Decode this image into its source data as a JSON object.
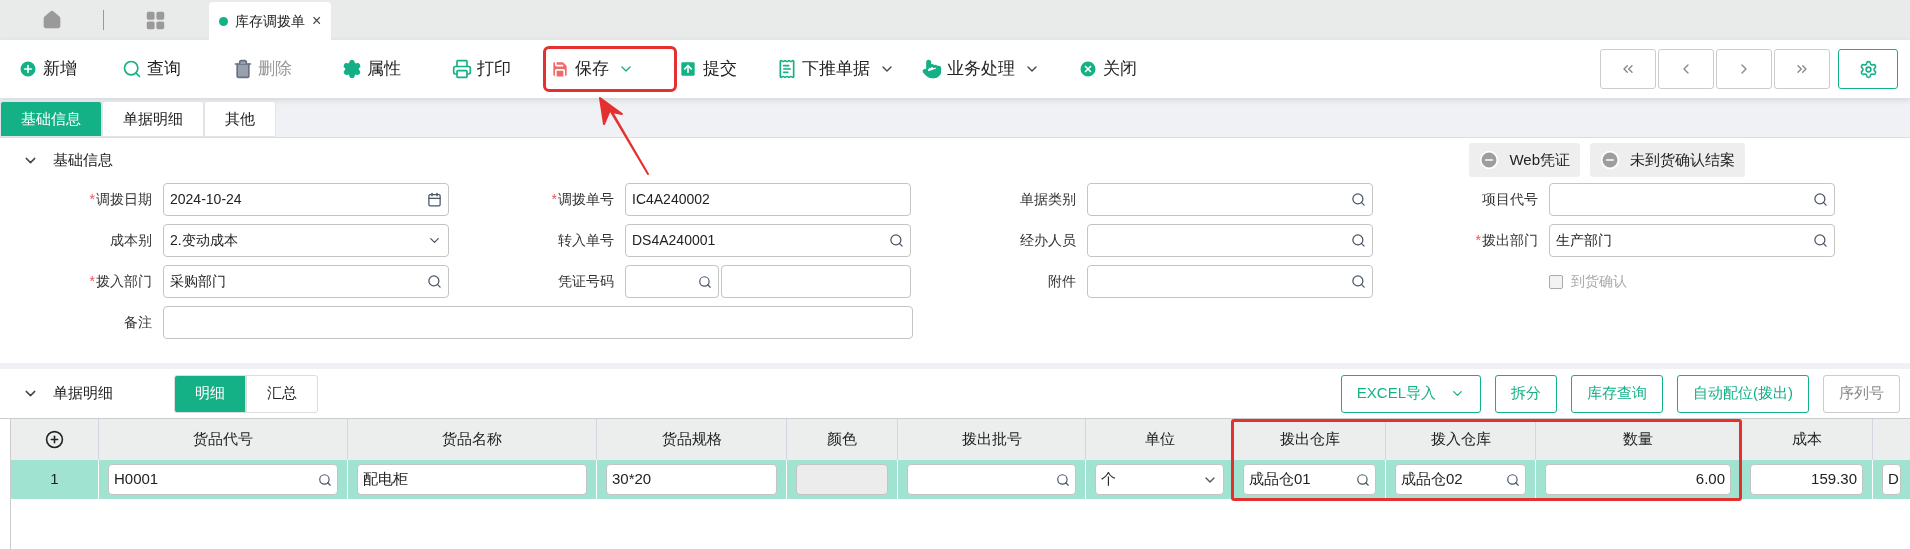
{
  "page_tabs": [
    {
      "kind": "home",
      "selected": false
    },
    {
      "kind": "apps",
      "selected": false
    },
    {
      "kind": "doc",
      "label": "库存调拨单",
      "close_glyph": "×",
      "selected": true
    }
  ],
  "toolbar": [
    {
      "label": "新增",
      "disabled": false,
      "dropdown": false,
      "highlighted": false
    },
    {
      "label": "查询",
      "disabled": false,
      "dropdown": false,
      "highlighted": false
    },
    {
      "label": "删除",
      "disabled": true,
      "dropdown": false,
      "highlighted": false
    },
    {
      "label": "属性",
      "disabled": false,
      "dropdown": false,
      "highlighted": false
    },
    {
      "label": "打印",
      "disabled": false,
      "dropdown": false,
      "highlighted": false
    },
    {
      "label": "保存",
      "disabled": false,
      "dropdown": true,
      "highlighted": true
    },
    {
      "label": "提交",
      "disabled": false,
      "dropdown": false,
      "highlighted": false
    },
    {
      "label": "下推单据",
      "disabled": false,
      "dropdown": true,
      "highlighted": false
    },
    {
      "label": "业务处理",
      "disabled": false,
      "dropdown": true,
      "highlighted": false
    },
    {
      "label": "关闭",
      "disabled": false,
      "dropdown": false,
      "highlighted": false
    }
  ],
  "form_tabs": [
    {
      "label": "基础信息",
      "selected": true
    },
    {
      "label": "单据明细",
      "selected": false
    },
    {
      "label": "其他",
      "selected": false
    }
  ],
  "basic_section": {
    "title": "基础信息",
    "expanded": true,
    "actions": [
      {
        "label": "Web凭证"
      },
      {
        "label": "未到货确认结案"
      }
    ]
  },
  "form_rows": [
    [
      {
        "label": "调拨日期",
        "required_mark": "*",
        "kind": "date",
        "value": "2024-10-24"
      },
      {
        "label": "调拨单号",
        "required_mark": "*",
        "kind": "text",
        "value": "IC4A240002"
      },
      {
        "label": "单据类别",
        "kind": "lookup"
      },
      {
        "label": "项目代号",
        "kind": "lookup"
      }
    ],
    [
      {
        "label": "成本别",
        "kind": "select",
        "value": "2.变动成本"
      },
      {
        "label": "转入单号",
        "kind": "lookup",
        "value": "DS4A240001"
      },
      {
        "label": "经办人员",
        "kind": "lookup"
      },
      {
        "label": "拨出部门",
        "required_mark": "*",
        "kind": "lookup",
        "value": "生产部门"
      }
    ],
    [
      {
        "label": "拨入部门",
        "required_mark": "*",
        "kind": "lookup",
        "value": "采购部门"
      },
      {
        "label": "凭证号码",
        "kind": "voucher"
      },
      {
        "label": "附件",
        "kind": "lookup"
      },
      {
        "label": "到货确认",
        "kind": "checkbox",
        "checked": false,
        "disabled": true
      }
    ],
    [
      {
        "label": "备注",
        "kind": "memo"
      }
    ]
  ],
  "detail_section": {
    "title": "单据明细",
    "expanded": true,
    "view_tabs": [
      {
        "label": "明细",
        "selected": true
      },
      {
        "label": "汇总",
        "selected": false
      }
    ],
    "actions": [
      {
        "label": "EXCEL导入",
        "dropdown": true,
        "disabled": false
      },
      {
        "label": "拆分",
        "dropdown": false,
        "disabled": false
      },
      {
        "label": "库存查询",
        "dropdown": false,
        "disabled": false
      },
      {
        "label": "自动配位(拨出)",
        "dropdown": false,
        "disabled": false
      },
      {
        "label": "序列号",
        "dropdown": false,
        "disabled": true
      }
    ]
  },
  "table": {
    "columns": [
      {
        "label": "货品代号",
        "highlighted": false
      },
      {
        "label": "货品名称",
        "highlighted": false
      },
      {
        "label": "货品规格",
        "highlighted": false
      },
      {
        "label": "颜色",
        "highlighted": false
      },
      {
        "label": "拨出批号",
        "highlighted": false
      },
      {
        "label": "单位",
        "highlighted": false
      },
      {
        "label": "拨出仓库",
        "highlighted": true
      },
      {
        "label": "拨入仓库",
        "highlighted": true
      },
      {
        "label": "数量",
        "highlighted": true
      },
      {
        "label": "成本",
        "highlighted": false
      }
    ],
    "rows": [
      {
        "index": "1",
        "selected": true,
        "cells": [
          {
            "kind": "lookup",
            "value": "H0001"
          },
          {
            "kind": "text",
            "value": "配电柜"
          },
          {
            "kind": "text",
            "value": "30*20"
          },
          {
            "kind": "disabled"
          },
          {
            "kind": "lookup"
          },
          {
            "kind": "select",
            "value": "个"
          },
          {
            "kind": "lookup",
            "value": "成品仓01"
          },
          {
            "kind": "lookup",
            "value": "成品仓02"
          },
          {
            "kind": "number",
            "value": "6.00"
          },
          {
            "kind": "number",
            "value": "159.30"
          },
          {
            "kind": "text",
            "value": "D"
          }
        ]
      }
    ]
  }
}
